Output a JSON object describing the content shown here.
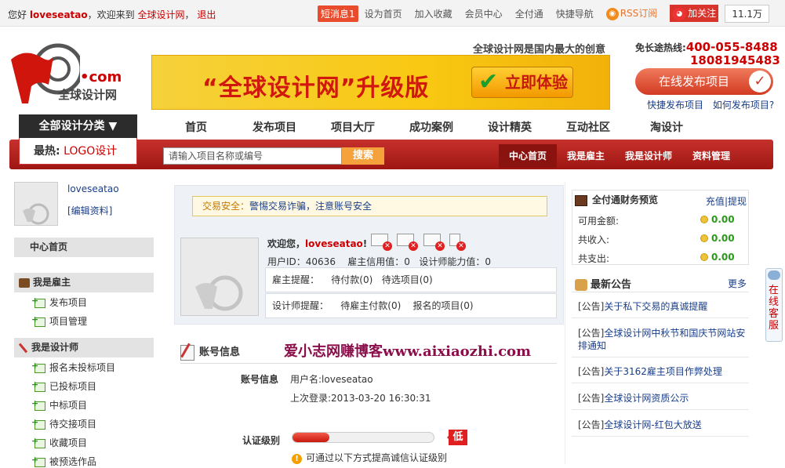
{
  "topbar": {
    "greeting": "您好",
    "username": "loveseatao",
    "welcome": "，欢迎来到",
    "site_name": "全球设计网",
    "sep": "，",
    "logout": "退出",
    "sms": "短消息1",
    "links": [
      "设为首页",
      "加入收藏",
      "会员中心",
      "全付通",
      "快捷导航"
    ],
    "rss": "RSS订阅",
    "follow": "加关注",
    "fans": "11.1万"
  },
  "logo": {
    "dotcom": "•com",
    "name": "全球设计网"
  },
  "banner": {
    "title": "“全球设计网”升级版",
    "cta": "立即体验"
  },
  "header": {
    "slogan": "全球设计网是国内最大的创意",
    "hotline_label": "免长途热线:",
    "hotline_1": "400-055-8488",
    "hotline_2": "18081945483",
    "publish_button": "在线发布项目",
    "quick_publish": "快捷发布项目",
    "how_publish": "如何发布项目?"
  },
  "nav": {
    "categories": "全部设计分类 ▼",
    "items": [
      "首页",
      "发布项目",
      "项目大厅",
      "成功案例",
      "设计精英",
      "互动社区",
      "淘设计"
    ],
    "hot_label": "最热:",
    "hot_value": "LOGO设计",
    "search_placeholder": "请输入项目名称或编号",
    "search_button": "搜索",
    "subnav": [
      "中心首页",
      "我是雇主",
      "我是设计师",
      "资料管理"
    ]
  },
  "sidebar": {
    "username": "loveseatao",
    "edit": "[编辑资料]",
    "home": "中心首页",
    "employer": "我是雇主",
    "employer_items": [
      "发布项目",
      "项目管理"
    ],
    "designer": "我是设计师",
    "designer_items": [
      "报名未投标项目",
      "已投标项目",
      "中标项目",
      "待交接项目",
      "收藏项目",
      "被预选作品"
    ]
  },
  "main": {
    "security_label": "交易安全：",
    "security_text": "警惕交易诈骗，注意账号安全",
    "welcome": "欢迎您，",
    "username": "loveseatao",
    "bang": "!",
    "user_id": "用户ID：40636",
    "employer_credit": "雇主信用值：0",
    "designer_ability": "设计师能力值：0",
    "employer_remind_label": "雇主提醒：",
    "employer_remind_1": "待付款(0)",
    "employer_remind_2": "待选项目(0)",
    "designer_remind_label": "设计师提醒：",
    "designer_remind_1": "待雇主付款(0)",
    "designer_remind_2": "报名的项目(0)",
    "account_title": "账号信息",
    "watermark": "爱小志网赚博客www.aixiaozhi.com",
    "account_info_label": "账号信息",
    "account_username": "用户名:loveseatao",
    "last_login": "上次登录:2013-03-20 16:30:31",
    "cert_label": "认证级别",
    "cert_progress": 0.26,
    "cert_level": "低",
    "cert_tip": "可通过以下方式提高诚信认证级别"
  },
  "finance": {
    "title": "全付通财务预览",
    "recharge": "充值",
    "sep": "|",
    "withdraw": "提现",
    "rows": [
      {
        "label": "可用金额:",
        "value": "0.00"
      },
      {
        "label": "共收入:",
        "value": "0.00"
      },
      {
        "label": "共支出:",
        "value": "0.00"
      }
    ]
  },
  "notices": {
    "title": "最新公告",
    "more": "更多",
    "items": [
      {
        "prefix": "[公告]",
        "text": "关于私下交易的真诚提醒"
      },
      {
        "prefix": "[公告]",
        "text": "全球设计网中秋节和国庆节网站安排通知"
      },
      {
        "prefix": "[公告]",
        "text": "关于3162雇主项目作弊处理"
      },
      {
        "prefix": "[公告]",
        "text": "全球设计网资质公示"
      },
      {
        "prefix": "[公告]",
        "text": "全球设计网-红包大放送"
      }
    ]
  },
  "kefu": {
    "label": "在线客服"
  }
}
